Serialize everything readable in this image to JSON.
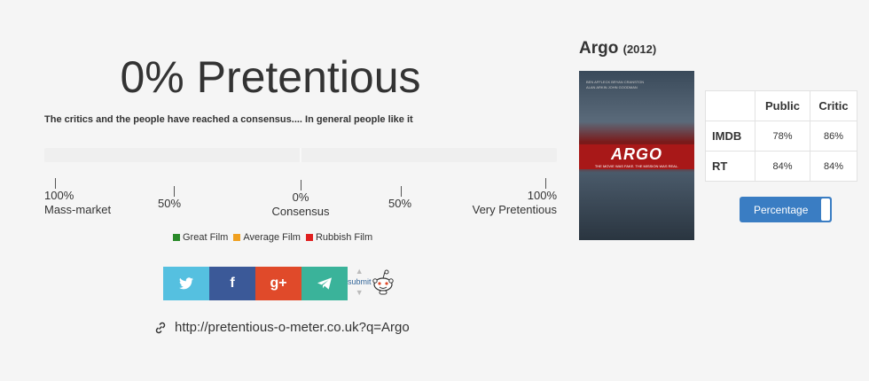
{
  "verdict": {
    "headline": "0% Pretentious",
    "consensus": "The critics and the people have reached a consensus.... In general people like it"
  },
  "scale": {
    "left": {
      "value": "100%",
      "label": "Mass-market"
    },
    "left_mid": {
      "value": "50%"
    },
    "center": {
      "value": "0%",
      "label": "Consensus"
    },
    "right_mid": {
      "value": "50%"
    },
    "right": {
      "value": "100%",
      "label": "Very Pretentious"
    }
  },
  "legend": [
    {
      "label": "Great Film",
      "color": "#2a8a2a"
    },
    {
      "label": "Average Film",
      "color": "#f0a020"
    },
    {
      "label": "Rubbish Film",
      "color": "#e02020"
    }
  ],
  "share": {
    "twitter_glyph": "🐦",
    "facebook_glyph": "f",
    "googleplus_glyph": "g+",
    "telegram_glyph": "➤",
    "colors": {
      "twitter": "#55c0e0",
      "facebook": "#3b5998",
      "googleplus": "#e04a2a",
      "telegram": "#3ab39a"
    },
    "icons": [
      "twitter-icon",
      "facebook-icon",
      "google-plus-icon",
      "telegram-icon"
    ],
    "reddit_submit": "submit"
  },
  "link": {
    "url": "http://pretentious-o-meter.co.uk?q=Argo",
    "icon": "link-icon"
  },
  "film": {
    "title": "Argo",
    "year": "(2012)",
    "poster": {
      "credits": [
        "BEN AFFLECK  BRYAN CRANSTON",
        "ALAN ARKIN  JOHN GOODMAN"
      ],
      "title": "ARGO",
      "tagline": "THE MOVIE WAS FAKE. THE MISSION WAS REAL."
    }
  },
  "ratings": {
    "headers": [
      "Public",
      "Critic"
    ],
    "rows": [
      {
        "source": "IMDB",
        "public": "78%",
        "critic": "86%"
      },
      {
        "source": "RT",
        "public": "84%",
        "critic": "84%"
      }
    ]
  },
  "toggle": {
    "label": "Percentage",
    "color": "#3a7dc3"
  }
}
